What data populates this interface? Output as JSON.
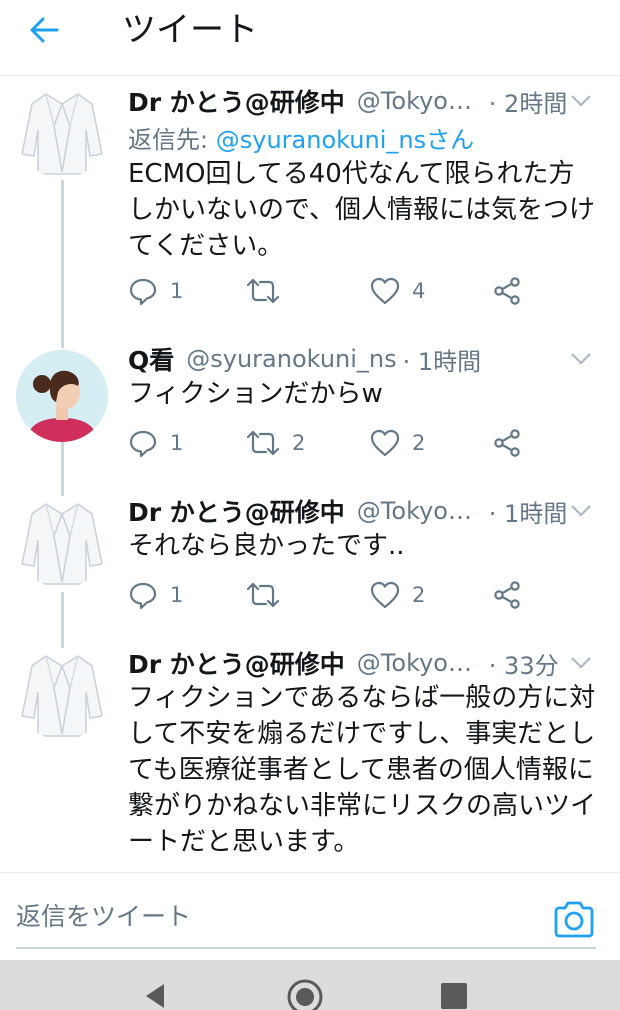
{
  "header": {
    "title": "ツイート",
    "back_icon": "arrow-left-icon",
    "accent_color": "#1da1f2"
  },
  "tweets": [
    {
      "avatar": "white-coat-avatar",
      "name": "Dr かとう@研修中",
      "handle": "@Tokyok...",
      "time": "· 2時間",
      "reply_to_prefix": "返信先:",
      "reply_to_mention": "@syuranokuni_nsさん",
      "text": "ECMO回してる40代なんて限られた方しかいないので、個人情報には気をつけてください。",
      "replies": "1",
      "retweets": "",
      "likes": "4"
    },
    {
      "avatar": "nurse-photo-avatar",
      "name": "Q看",
      "handle": "@syuranokuni_ns",
      "time": "· 1時間",
      "text": "フィクションだからw",
      "replies": "1",
      "retweets": "2",
      "likes": "2"
    },
    {
      "avatar": "white-coat-avatar",
      "name": "Dr かとう@研修中",
      "handle": "@Tokyok...",
      "time": "· 1時間",
      "text": "それなら良かったです..",
      "replies": "1",
      "retweets": "",
      "likes": "2"
    },
    {
      "avatar": "white-coat-avatar",
      "name": "Dr かとう@研修中",
      "handle": "@Tokyok...",
      "time": "· 33分",
      "text": "フィクションであるならば一般の方に対して不安を煽るだけですし、事実だとしても医療従事者として患者の個人情報に繋がりかねない非常にリスクの高いツイートだと思います。"
    }
  ],
  "compose": {
    "placeholder": "返信をツイート",
    "camera_icon": "camera-icon"
  },
  "system_nav": {
    "back_icon": "nav-back-icon",
    "home_icon": "nav-home-icon",
    "recents_icon": "nav-recents-icon"
  }
}
